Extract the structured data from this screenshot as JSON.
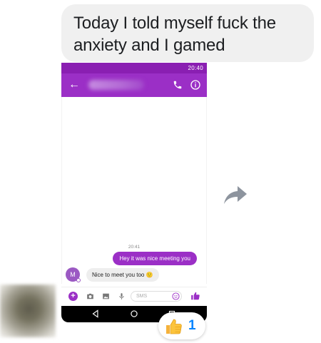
{
  "message": {
    "text_line1": "Today I told myself fuck the",
    "text_line2": "anxiety and I gamed"
  },
  "screenshot": {
    "status_time": "20:40",
    "timestamp": "20:41",
    "outgoing_message": "Hey it was nice meeting you",
    "incoming_avatar_initial": "M",
    "incoming_message": "Nice to meet you too 🙂",
    "composer_placeholder": "SMS",
    "accent_color": "#9b2fc6"
  },
  "reaction": {
    "emoji": "👍",
    "count": "1"
  },
  "icons": {
    "share": "share-arrow-icon",
    "back": "back-arrow-icon",
    "call": "phone-icon",
    "info": "info-icon"
  }
}
